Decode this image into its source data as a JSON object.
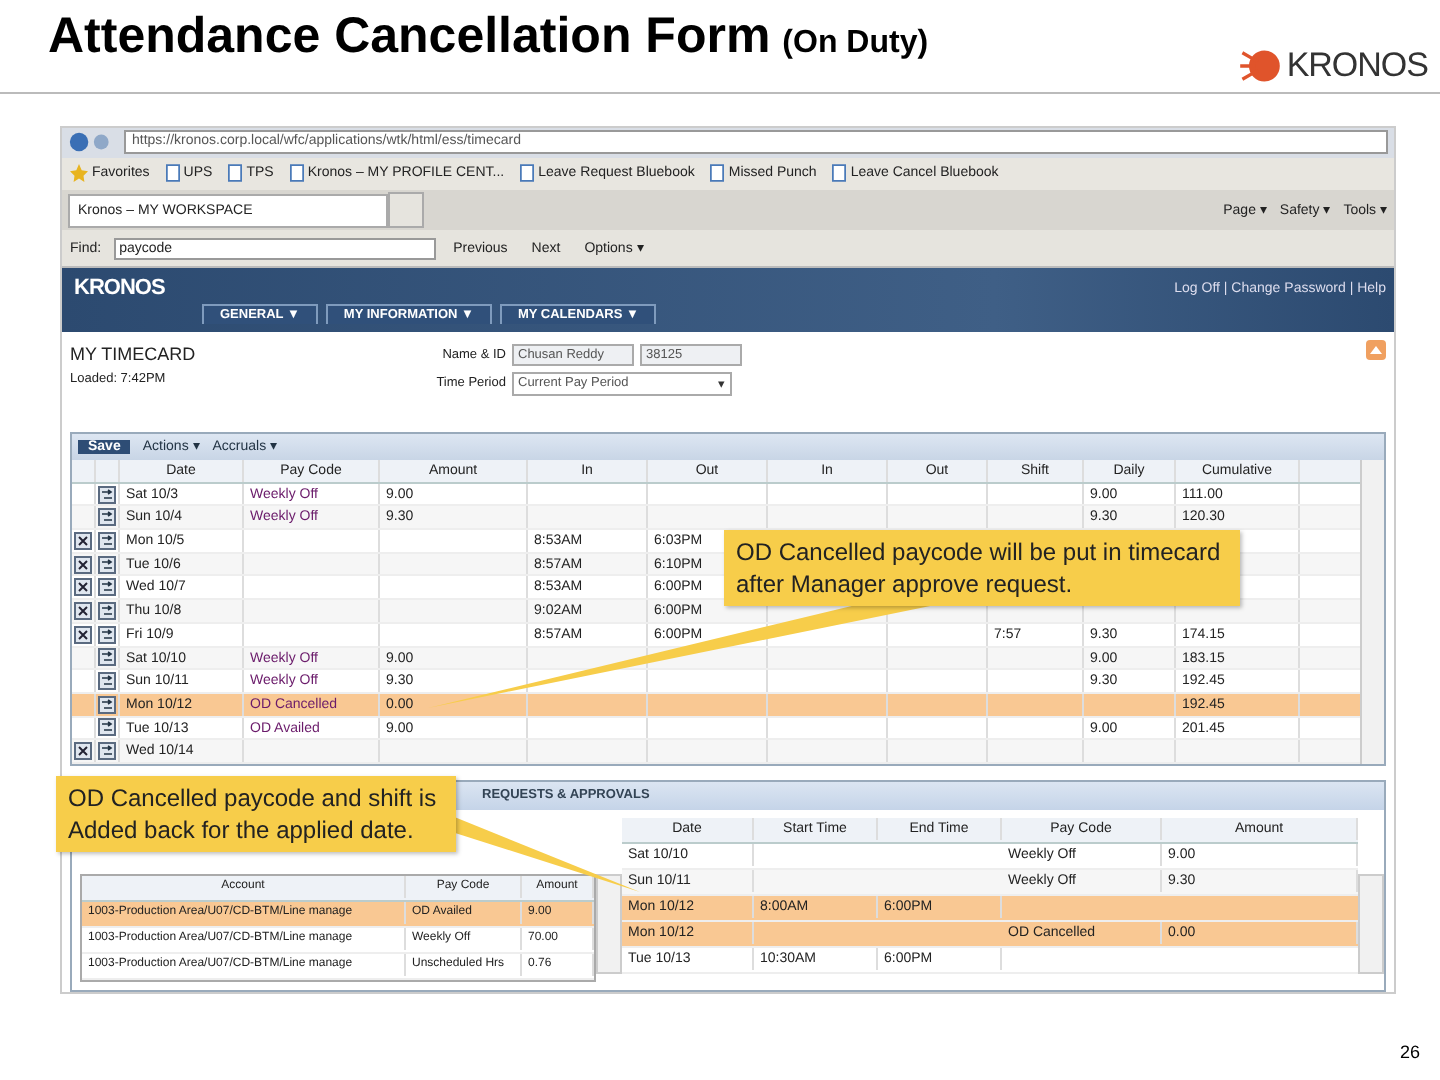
{
  "slide": {
    "title": "Attendance Cancellation Form",
    "subtitle": "(On Duty)",
    "logo": "KRONOS",
    "page_number": "26"
  },
  "browser": {
    "address": "https://kronos.corp.local/wfc/applications/wtk/html/ess/timecard",
    "favorites_label": "Favorites",
    "favorites": [
      "UPS",
      "TPS",
      "Kronos – MY PROFILE CENT...",
      "Leave Request Bluebook",
      "Missed Punch",
      "Leave Cancel Bluebook"
    ],
    "tab": "Kronos – MY WORKSPACE",
    "tools": [
      "Page ▾",
      "Safety ▾",
      "Tools ▾"
    ],
    "find": {
      "label": "Find:",
      "value": "paycode",
      "buttons": [
        "Previous",
        "Next",
        "Options ▾"
      ]
    }
  },
  "app": {
    "logo": "KRONOS",
    "links": "Log Off | Change Password | Help",
    "nav": [
      "GENERAL ▼",
      "MY INFORMATION ▼",
      "MY CALENDARS ▼"
    ]
  },
  "timecard": {
    "title": "MY TIMECARD",
    "loaded": "Loaded: 7:42PM",
    "name_label": "Name & ID",
    "name": "Chusan Reddy",
    "id": "38125",
    "period_label": "Time Period",
    "period": "Current Pay Period",
    "period_arrow": "▾",
    "save": "Save",
    "menus": [
      "Actions ▾",
      "Accruals ▾"
    ],
    "columns": [
      "Date",
      "Pay Code",
      "Amount",
      "In",
      "Out",
      "In",
      "Out",
      "Shift",
      "Daily",
      "Cumulative"
    ],
    "rows": [
      {
        "deletable": false,
        "selected": false,
        "cells": [
          "Sat 10/3",
          "Weekly Off",
          "9.00",
          "",
          "",
          "",
          "",
          "",
          "9.00",
          "111.00"
        ]
      },
      {
        "deletable": false,
        "selected": false,
        "cells": [
          "Sun 10/4",
          "Weekly Off",
          "9.30",
          "",
          "",
          "",
          "",
          "",
          "9.30",
          "120.30"
        ]
      },
      {
        "deletable": true,
        "selected": false,
        "cells": [
          "Mon 10/5",
          "",
          "",
          "8:53AM",
          "6:03PM",
          "",
          "",
          "",
          "",
          ""
        ]
      },
      {
        "deletable": true,
        "selected": false,
        "cells": [
          "Tue 10/6",
          "",
          "",
          "8:57AM",
          "6:10PM",
          "",
          "",
          "",
          "",
          ""
        ]
      },
      {
        "deletable": true,
        "selected": false,
        "cells": [
          "Wed 10/7",
          "",
          "",
          "8:53AM",
          "6:00PM",
          "",
          "",
          "",
          "",
          ""
        ]
      },
      {
        "deletable": true,
        "selected": false,
        "cells": [
          "Thu 10/8",
          "",
          "",
          "9:02AM",
          "6:00PM",
          "",
          "",
          "",
          "",
          ""
        ]
      },
      {
        "deletable": true,
        "selected": false,
        "cells": [
          "Fri 10/9",
          "",
          "",
          "8:57AM",
          "6:00PM",
          "",
          "",
          "7:57",
          "9.30",
          "174.15"
        ]
      },
      {
        "deletable": false,
        "selected": false,
        "cells": [
          "Sat 10/10",
          "Weekly Off",
          "9.00",
          "",
          "",
          "",
          "",
          "",
          "9.00",
          "183.15"
        ]
      },
      {
        "deletable": false,
        "selected": false,
        "cells": [
          "Sun 10/11",
          "Weekly Off",
          "9.30",
          "",
          "",
          "",
          "",
          "",
          "9.30",
          "192.45"
        ]
      },
      {
        "deletable": false,
        "selected": true,
        "cells": [
          "Mon 10/12",
          "OD Cancelled",
          "0.00",
          "",
          "",
          "",
          "",
          "",
          "",
          "192.45"
        ]
      },
      {
        "deletable": false,
        "selected": false,
        "cells": [
          "Tue 10/13",
          "OD Availed",
          "9.00",
          "",
          "",
          "",
          "",
          "",
          "9.00",
          "201.45"
        ]
      },
      {
        "deletable": true,
        "selected": false,
        "cells": [
          "Wed 10/14",
          "",
          "",
          "",
          "",
          "",
          "",
          "",
          "",
          ""
        ]
      }
    ]
  },
  "requests": {
    "title": "REQUESTS & APPROVALS",
    "left": {
      "columns": [
        "Account",
        "Pay Code",
        "Amount"
      ],
      "rows": [
        {
          "selected": true,
          "cells": [
            "1003-Production Area/U07/CD-BTM/Line manage",
            "OD Availed",
            "9.00"
          ]
        },
        {
          "selected": false,
          "cells": [
            "1003-Production Area/U07/CD-BTM/Line manage",
            "Weekly Off",
            "70.00"
          ]
        },
        {
          "selected": false,
          "cells": [
            "1003-Production Area/U07/CD-BTM/Line manage",
            "Unscheduled Hrs",
            "0.76"
          ]
        }
      ]
    },
    "right": {
      "columns": [
        "Date",
        "Start Time",
        "End Time",
        "Pay Code",
        "Amount"
      ],
      "rows": [
        {
          "selected": false,
          "cells": [
            "Sat 10/10",
            "",
            "",
            "Weekly Off",
            "9.00"
          ]
        },
        {
          "selected": false,
          "cells": [
            "Sun 10/11",
            "",
            "",
            "Weekly Off",
            "9.30"
          ]
        },
        {
          "selected": true,
          "cells": [
            "Mon 10/12",
            "8:00AM",
            "6:00PM",
            "",
            ""
          ]
        },
        {
          "selected": true,
          "cells": [
            "Mon 10/12",
            "",
            "",
            "OD Cancelled",
            "0.00"
          ]
        },
        {
          "selected": false,
          "cells": [
            "Tue 10/13",
            "10:30AM",
            "6:00PM",
            "",
            ""
          ]
        }
      ]
    }
  },
  "callouts": [
    "OD Cancelled paycode will be put in timecard after Manager approve request.",
    "OD Cancelled paycode and shift is Added back for the applied date."
  ]
}
